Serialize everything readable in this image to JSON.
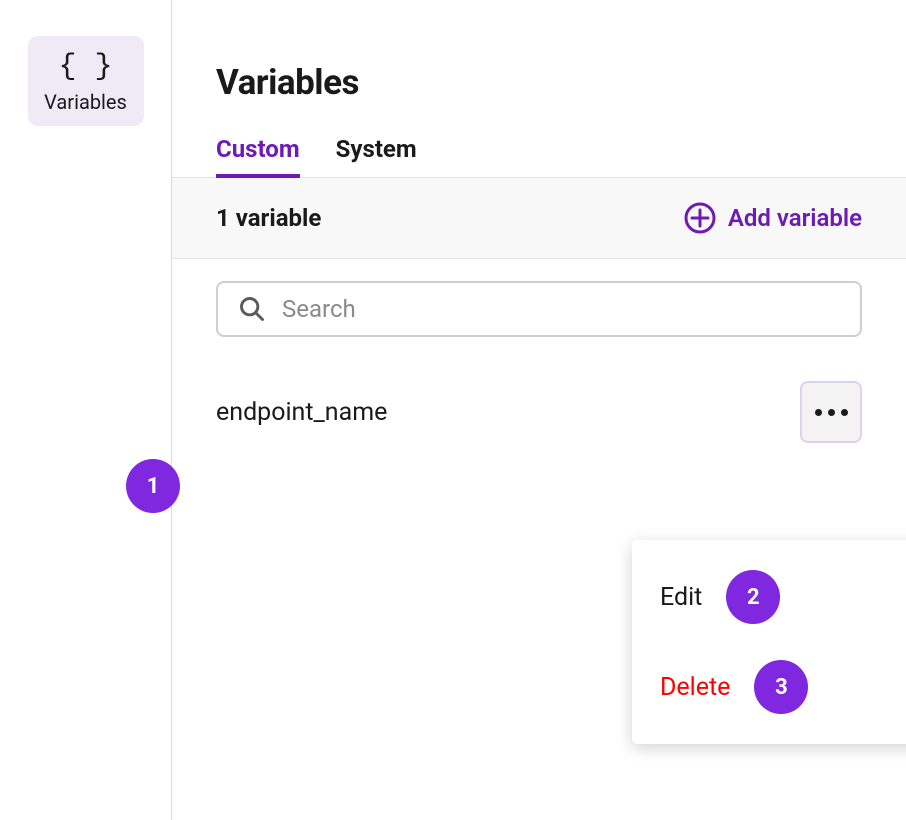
{
  "sidebar": {
    "icon_symbol": "{ }",
    "label": "Variables"
  },
  "page": {
    "title": "Variables"
  },
  "tabs": {
    "custom": "Custom",
    "system": "System"
  },
  "toolbar": {
    "count_text": "1 variable",
    "add_label": "Add variable"
  },
  "search": {
    "placeholder": "Search"
  },
  "variables": [
    {
      "name": "endpoint_name"
    }
  ],
  "menu": {
    "edit": "Edit",
    "delete": "Delete"
  },
  "annotations": {
    "one": "1",
    "two": "2",
    "three": "3"
  },
  "colors": {
    "accent": "#6e1bb5",
    "badge": "#8028e0",
    "danger": "#ff0000"
  }
}
